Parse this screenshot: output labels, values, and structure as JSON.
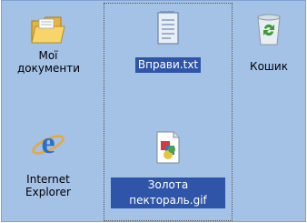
{
  "desktop": {
    "icons": [
      {
        "name": "my-documents",
        "label_line1": "Мої",
        "label_line2": "документи",
        "selected": false
      },
      {
        "name": "vpravy",
        "label_line1": "Вправи.txt",
        "selected": true
      },
      {
        "name": "recycle-bin",
        "label_line1": "Кошик",
        "selected": false
      },
      {
        "name": "internet-explorer",
        "label_line1": "Internet",
        "label_line2": "Explorer",
        "selected": false
      },
      {
        "name": "zolota-pektoral",
        "label_line1": "Золота",
        "label_line2": "пектораль.gif",
        "selected": true
      }
    ],
    "colors": {
      "background": "#a4c1e6",
      "selection": "#2f55a8",
      "folder": "#f2cd5b"
    }
  }
}
